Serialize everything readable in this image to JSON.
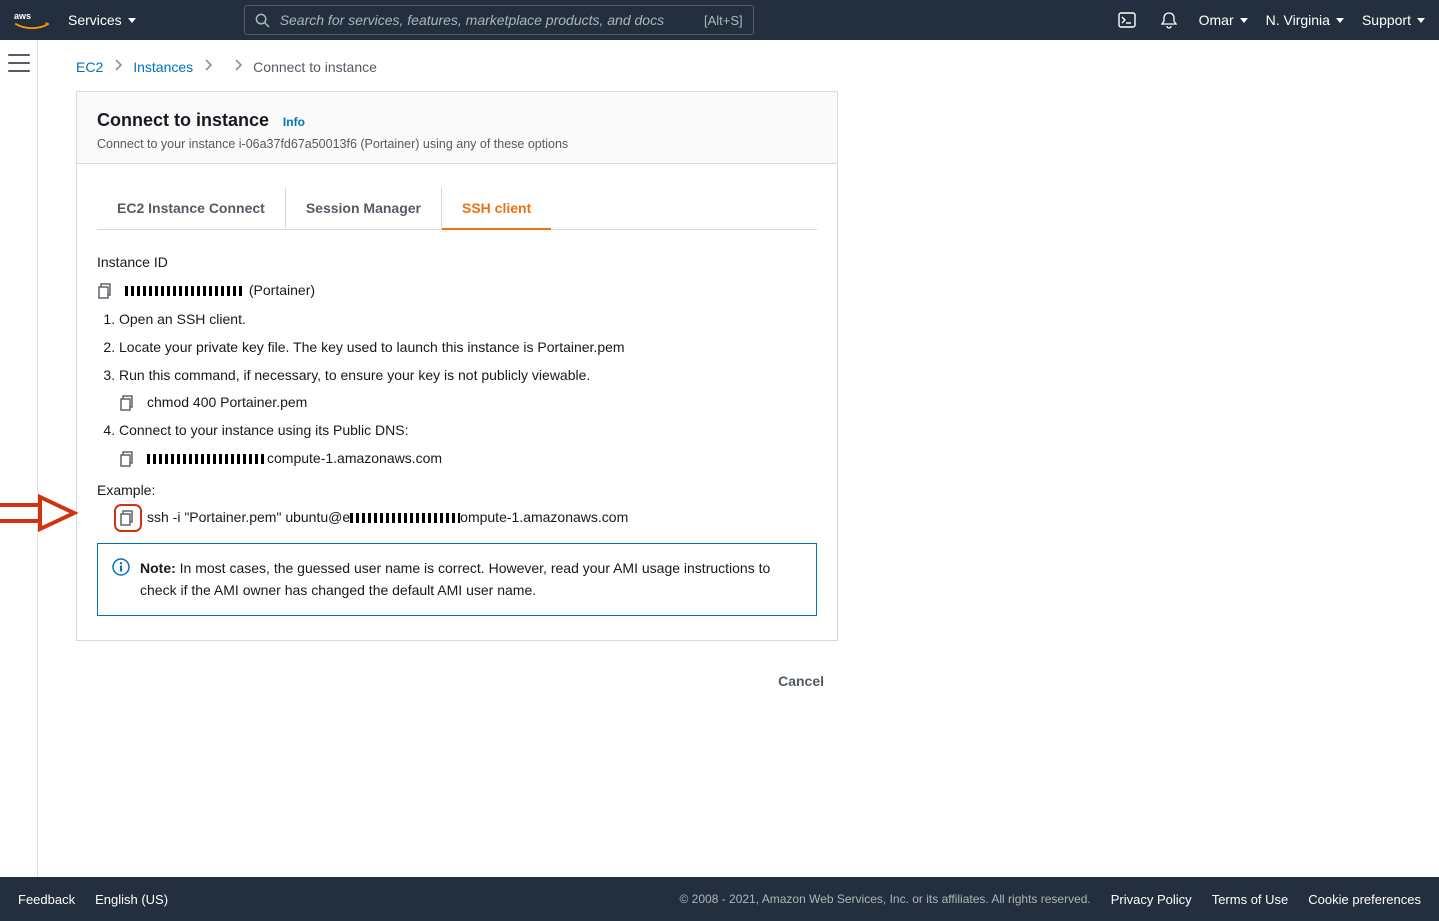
{
  "topnav": {
    "services_label": "Services",
    "search_placeholder": "Search for services, features, marketplace products, and docs",
    "search_hotkey": "[Alt+S]",
    "user": "Omar",
    "region": "N. Virginia",
    "support": "Support"
  },
  "breadcrumb": {
    "root": "EC2",
    "level1": "Instances",
    "current": "Connect to instance"
  },
  "panel": {
    "title": "Connect to instance",
    "info_label": "Info",
    "subtitle": "Connect to your instance i-06a37fd67a50013f6 (Portainer) using any of these options"
  },
  "tabs": {
    "ec2_connect": "EC2 Instance Connect",
    "session_manager": "Session Manager",
    "ssh_client": "SSH client"
  },
  "ssh": {
    "instance_id_label": "Instance ID",
    "instance_id_value": "i-06a37fd67a50013f6",
    "instance_label_suffix": "(Portainer)",
    "step1": "Open an SSH client.",
    "step2": "Locate your private key file. The key used to launch this instance is Portainer.pem",
    "step3": "Run this command, if necessary, to ensure your key is not publicly viewable.",
    "chmod_cmd": "chmod 400 Portainer.pem",
    "step4": "Connect to your instance using its Public DNS:",
    "dns_suffix": "compute-1.amazonaws.com",
    "example_label": "Example:",
    "example_prefix": "ssh -i \"Portainer.pem\" ubuntu@e",
    "example_suffix": "ompute-1.amazonaws.com",
    "note_label": "Note:",
    "note_text": " In most cases, the guessed user name is correct. However, read your AMI usage instructions to check if the AMI owner has changed the default AMI user name."
  },
  "actions": {
    "cancel": "Cancel"
  },
  "footer": {
    "feedback": "Feedback",
    "language": "English (US)",
    "copyright": "© 2008 - 2021, Amazon Web Services, Inc. or its affiliates. All rights reserved.",
    "privacy": "Privacy Policy",
    "terms": "Terms of Use",
    "cookie": "Cookie preferences"
  }
}
